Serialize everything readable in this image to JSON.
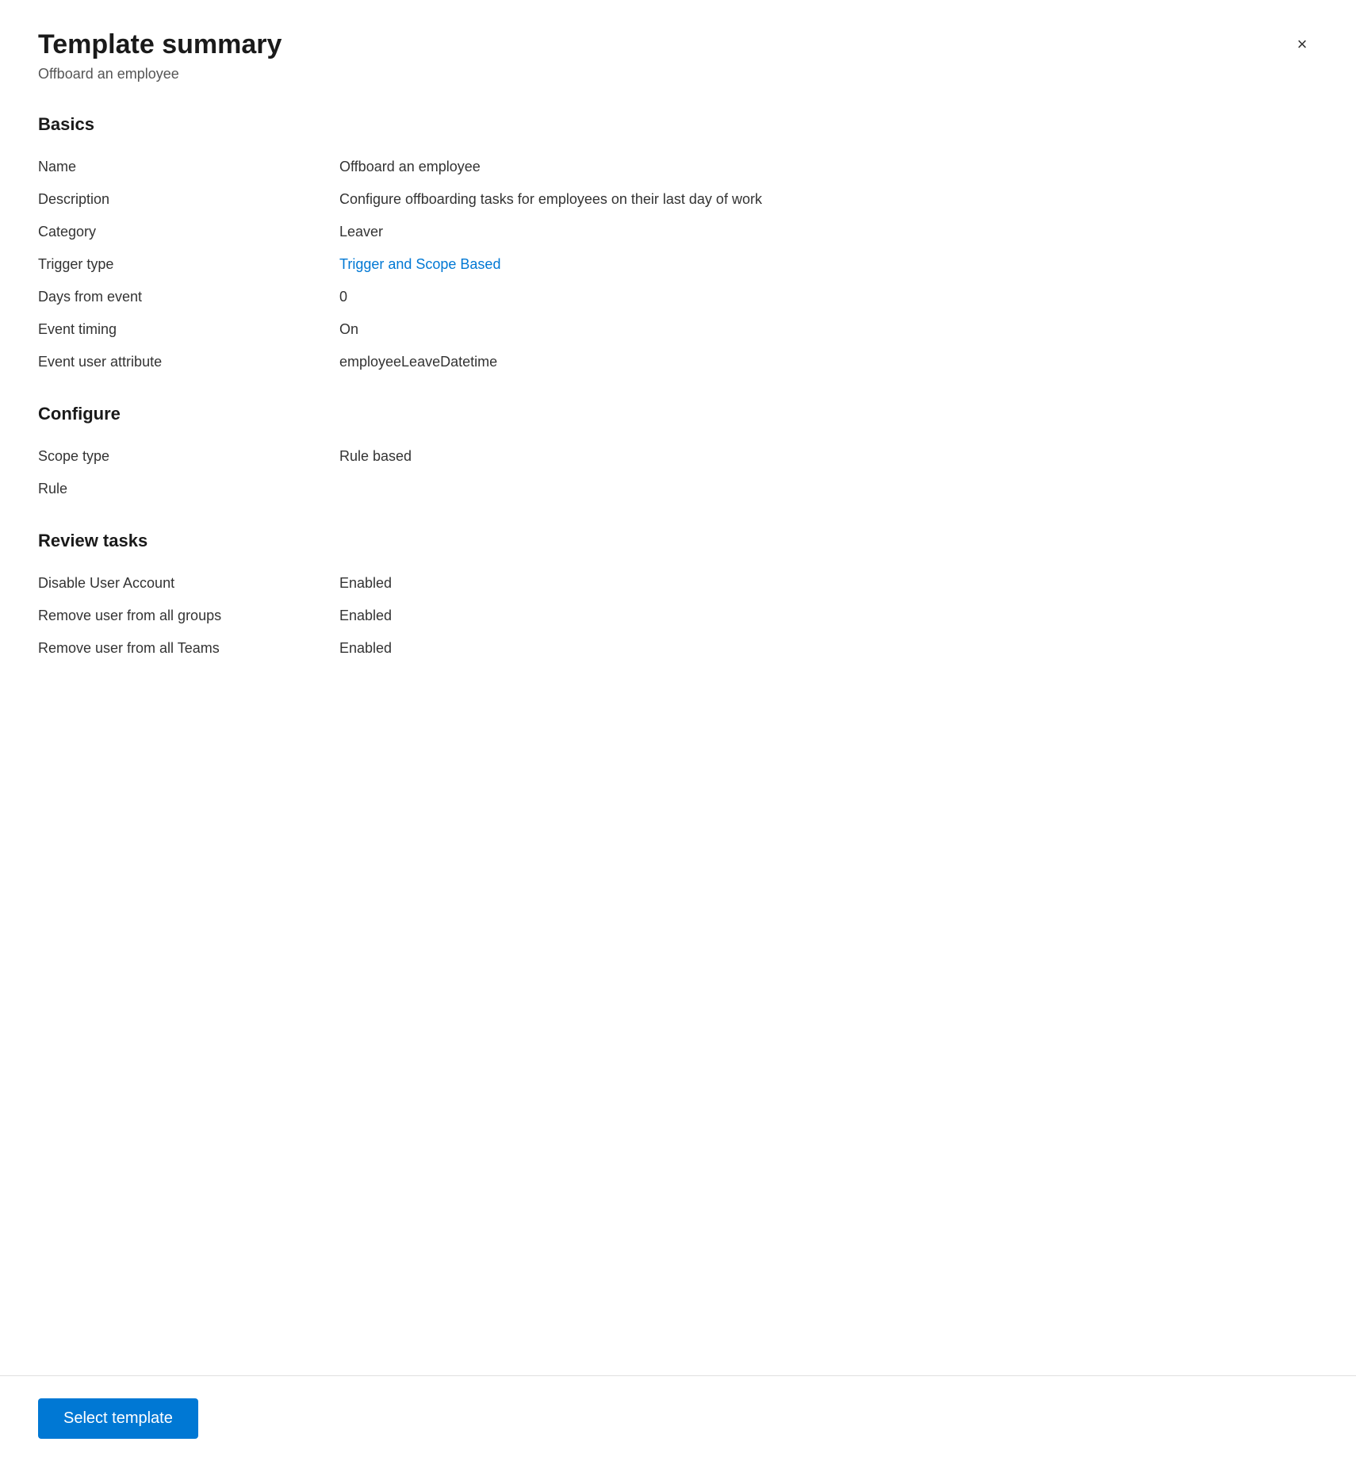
{
  "header": {
    "title": "Template summary",
    "subtitle": "Offboard an employee",
    "close_label": "×"
  },
  "basics": {
    "section_label": "Basics",
    "fields": [
      {
        "label": "Name",
        "value": "Offboard an employee",
        "link": false
      },
      {
        "label": "Description",
        "value": "Configure offboarding tasks for employees on their last day of work",
        "link": false
      },
      {
        "label": "Category",
        "value": "Leaver",
        "link": false
      },
      {
        "label": "Trigger type",
        "value": "Trigger and Scope Based",
        "link": true
      },
      {
        "label": "Days from event",
        "value": "0",
        "link": false
      },
      {
        "label": "Event timing",
        "value": "On",
        "link": false
      },
      {
        "label": "Event user attribute",
        "value": "employeeLeaveDatetime",
        "link": false
      }
    ]
  },
  "configure": {
    "section_label": "Configure",
    "fields": [
      {
        "label": "Scope type",
        "value": "Rule based",
        "link": false
      },
      {
        "label": "Rule",
        "value": "",
        "link": false
      }
    ]
  },
  "review_tasks": {
    "section_label": "Review tasks",
    "fields": [
      {
        "label": "Disable User Account",
        "value": "Enabled",
        "link": true
      },
      {
        "label": "Remove user from all groups",
        "value": "Enabled",
        "link": true
      },
      {
        "label": "Remove user from all Teams",
        "value": "Enabled",
        "link": true
      }
    ]
  },
  "footer": {
    "select_template_label": "Select template"
  }
}
